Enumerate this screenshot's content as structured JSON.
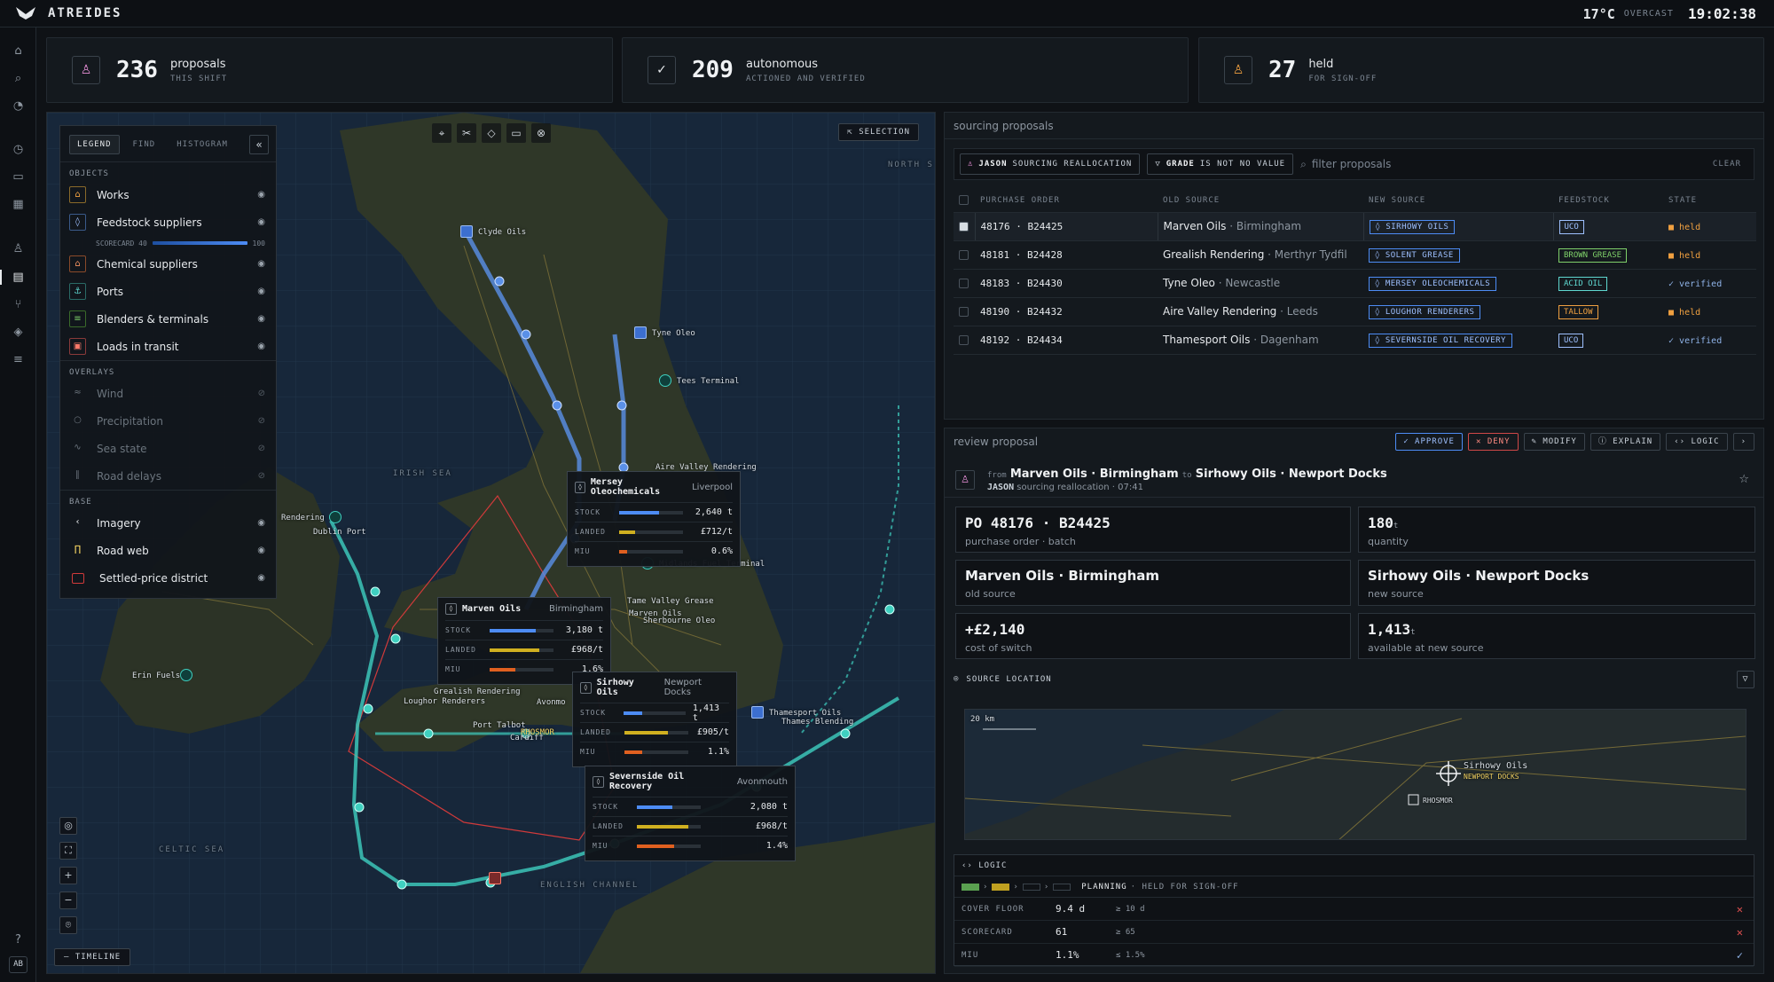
{
  "app": {
    "name": "ATREIDES"
  },
  "weather": {
    "temp": "17°C",
    "condition": "OVERCAST",
    "time": "19:02:38"
  },
  "stats": [
    {
      "value": "236",
      "label": "proposals",
      "sub": "THIS SHIFT",
      "color": "#e88fd8"
    },
    {
      "value": "209",
      "label": "autonomous",
      "sub": "ACTIONED AND VERIFIED",
      "color": "#e6e9ec"
    },
    {
      "value": "27",
      "label": "held",
      "sub": "FOR SIGN-OFF",
      "color": "#f0a040"
    }
  ],
  "legend": {
    "tabs": [
      "LEGEND",
      "FIND",
      "HISTOGRAM"
    ],
    "sections": {
      "objects": "OBJECTS",
      "overlays": "OVERLAYS",
      "base": "BASE"
    },
    "objects": [
      "Works",
      "Feedstock suppliers",
      "Chemical suppliers",
      "Ports",
      "Blenders & terminals",
      "Loads in transit"
    ],
    "scorecard": {
      "label": "SCORECARD 40",
      "max": "100"
    },
    "overlays": [
      "Wind",
      "Precipitation",
      "Sea state",
      "Road delays"
    ],
    "base": [
      "Imagery",
      "Road web",
      "Settled-price district"
    ]
  },
  "map": {
    "selection": "SELECTION",
    "timeline": "TIMELINE",
    "sea_labels": [
      "IRISH SEA",
      "CELTIC SEA",
      "ENGLISH CHANNEL",
      "NORTH S"
    ],
    "labels": [
      "Clyde Oils",
      "Tyne Oleo",
      "Tees Terminal",
      "Aire Valley Rendering",
      "Dublin Port",
      "Rendering",
      "Midlands Fuel Terminal",
      "Tame Valley Grease",
      "Marven Oils",
      "Sherbourne Oleo",
      "Erin Fuels",
      "Grealish Rendering",
      "Loughor Renderers",
      "Port Talbot",
      "Cardiff",
      "RHOSMOR",
      "Avonmo",
      "Thamesport Oils",
      "Thames Blending"
    ],
    "cards": [
      {
        "name": "Mersey Oleochemicals",
        "loc": "Liverpool",
        "stock": "2,640 t",
        "landed": "£712/t",
        "miu": "0.6%",
        "stock_f": 0.62,
        "landed_f": 0.25,
        "miu_f": 0.12
      },
      {
        "name": "Marven Oils",
        "loc": "Birmingham",
        "stock": "3,180 t",
        "landed": "£968/t",
        "miu": "1.6%",
        "stock_f": 0.72,
        "landed_f": 0.78,
        "miu_f": 0.4
      },
      {
        "name": "Sirhowy Oils",
        "loc": "Newport Docks",
        "stock": "1,413 t",
        "landed": "£905/t",
        "miu": "1.1%",
        "stock_f": 0.3,
        "landed_f": 0.68,
        "miu_f": 0.28
      },
      {
        "name": "Severnside Oil Recovery",
        "loc": "Avonmouth",
        "stock": "2,080 t",
        "landed": "£968/t",
        "miu": "1.4%",
        "stock_f": 0.55,
        "landed_f": 0.8,
        "miu_f": 0.58
      }
    ],
    "card_keys": {
      "stock": "STOCK",
      "landed": "LANDED",
      "miu": "MIU"
    }
  },
  "sourcing": {
    "title": "sourcing proposals",
    "chips": [
      {
        "bold": "JASON",
        "rest": "SOURCING REALLOCATION"
      },
      {
        "bold": "GRADE",
        "rest": "IS NOT NO VALUE"
      }
    ],
    "search_placeholder": "filter proposals",
    "clear": "CLEAR",
    "columns": [
      "PURCHASE ORDER",
      "OLD SOURCE",
      "NEW SOURCE",
      "FEEDSTOCK",
      "STATE"
    ],
    "rows": [
      {
        "po": "48176 · B24425",
        "old": "Marven Oils",
        "old_loc": "· Birmingham",
        "new": "SIRHOWY OILS",
        "feed": "UCO",
        "feed_color": "#9ec0ff",
        "state": "held"
      },
      {
        "po": "48181 · B24428",
        "old": "Grealish Rendering",
        "old_loc": "· Merthyr Tydfil",
        "new": "SOLENT GREASE",
        "feed": "BROWN GREASE",
        "feed_color": "#7fd06a",
        "state": "held"
      },
      {
        "po": "48183 · B24430",
        "old": "Tyne Oleo",
        "old_loc": "· Newcastle",
        "new": "MERSEY OLEOCHEMICALS",
        "feed": "ACID OIL",
        "feed_color": "#5fd8d0",
        "state": "verified"
      },
      {
        "po": "48190 · B24432",
        "old": "Aire Valley Rendering",
        "old_loc": "· Leeds",
        "new": "LOUGHOR RENDERERS",
        "feed": "TALLOW",
        "feed_color": "#f0a040",
        "state": "held"
      },
      {
        "po": "48192 · B24434",
        "old": "Thamesport Oils",
        "old_loc": "· Dagenham",
        "new": "SEVERNSIDE OIL RECOVERY",
        "feed": "UCO",
        "feed_color": "#9ec0ff",
        "state": "verified"
      }
    ]
  },
  "review": {
    "title": "review proposal",
    "buttons": [
      "APPROVE",
      "DENY",
      "MODIFY",
      "EXPLAIN",
      "LOGIC"
    ],
    "from_word": "from",
    "from": "Marven Oils · Birmingham",
    "to_word": "to",
    "to": "Sirhowy Oils · Newport Docks",
    "owner": "JASON",
    "desc": "sourcing reallocation · 07:41",
    "po": "PO 48176 · B24425",
    "po_label": "purchase order · batch",
    "qty": "180",
    "qty_unit": "t",
    "qty_label": "quantity",
    "old": "Marven Oils · Birmingham",
    "old_label": "old source",
    "new": "Sirhowy Oils · Newport Docks",
    "new_label": "new source",
    "cost": "+£2,140",
    "cost_label": "cost of switch",
    "avail": "1,413",
    "avail_unit": "t",
    "avail_label": "available at new source",
    "source_location": "SOURCE LOCATION",
    "minimap": {
      "scale": "20 km",
      "site": "Sirhowy Oils",
      "site_sub": "NEWPORT DOCKS",
      "marker": "RHOSMOR"
    },
    "logic": {
      "title": "LOGIC",
      "stage": "PLANNING",
      "stage_note": "· HELD FOR SIGN-OFF",
      "rows": [
        {
          "k": "COVER FLOOR",
          "v": "9.4 d",
          "t": "≥ 10 d",
          "pass": false
        },
        {
          "k": "SCORECARD",
          "v": "61",
          "t": "≥ 65",
          "pass": false
        },
        {
          "k": "MIU",
          "v": "1.1%",
          "t": "≤ 1.5%",
          "pass": true
        }
      ]
    }
  }
}
